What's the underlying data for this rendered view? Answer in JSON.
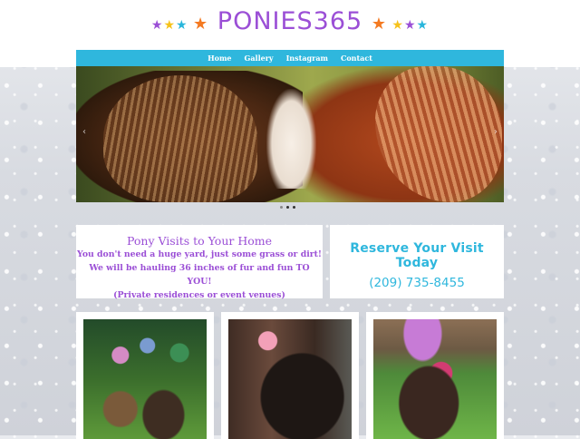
{
  "logo": {
    "text": "PONIES365"
  },
  "nav": {
    "items": [
      {
        "label": "Home"
      },
      {
        "label": "Gallery"
      },
      {
        "label": "Instagram"
      },
      {
        "label": "Contact"
      }
    ]
  },
  "hero": {
    "slides_count": 3,
    "active_slide": 2
  },
  "visits": {
    "title": "Pony Visits to Your Home",
    "lines": [
      "You don't need a huge yard, just some grass or dirt!",
      "We will be hauling 36 inches of fur and fun TO YOU!",
      "(Private residences or event venues)"
    ]
  },
  "reserve": {
    "title": "Reserve Your Visit Today",
    "phone": "(209) 735-8455"
  },
  "colors": {
    "brand_purple": "#9b4fd6",
    "accent_blue": "#2fb7dd",
    "star_yellow": "#f6c21b",
    "star_orange": "#f47a22"
  },
  "icons": {
    "prev": "chevron-left-icon",
    "next": "chevron-right-icon",
    "stars": "star-icon"
  }
}
